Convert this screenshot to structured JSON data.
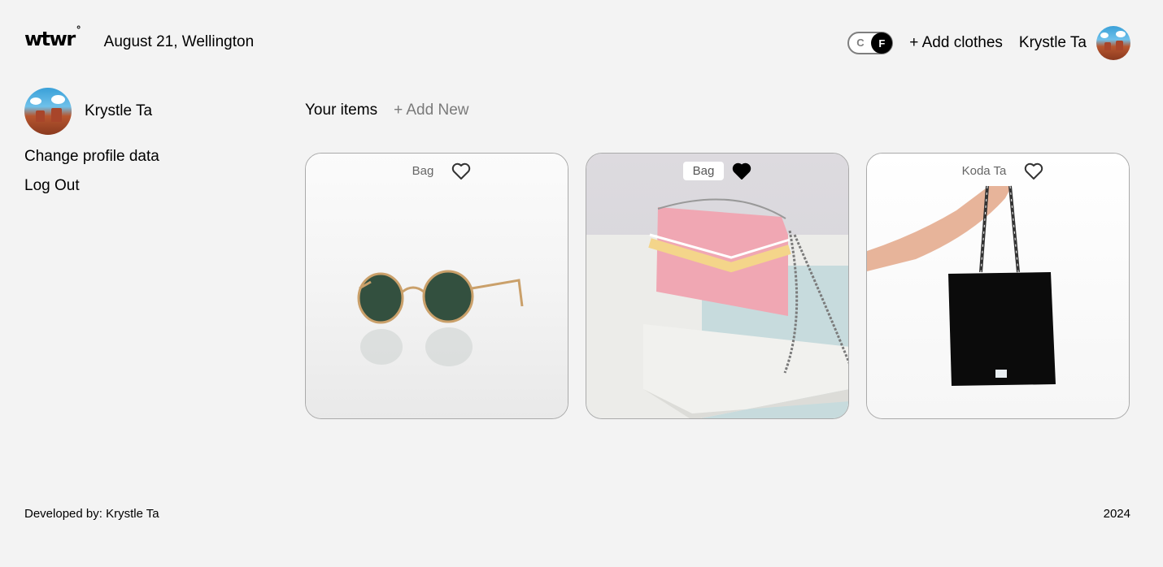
{
  "header": {
    "logo": "wtwr",
    "logo_mark": "°",
    "date_location": "August 21, Wellington",
    "toggle": {
      "off_label": "C",
      "on_label": "F",
      "selected": "F"
    },
    "add_clothes": "+ Add clothes",
    "username": "Krystle Ta"
  },
  "sidebar": {
    "username": "Krystle Ta",
    "change_profile": "Change profile data",
    "logout": "Log Out"
  },
  "main": {
    "title": "Your items",
    "add_new": "+ Add New",
    "cards": [
      {
        "label": "Bag",
        "liked": false,
        "image": "sunglasses"
      },
      {
        "label": "Bag",
        "liked": true,
        "image": "pink-handbag"
      },
      {
        "label": "Koda Ta",
        "liked": false,
        "image": "black-tote-bag"
      }
    ]
  },
  "footer": {
    "developer": "Developed by: Krystle Ta",
    "year": "2024"
  },
  "colors": {
    "background": "#f3f3f3",
    "text": "#000000",
    "muted": "#7a7a7a"
  }
}
